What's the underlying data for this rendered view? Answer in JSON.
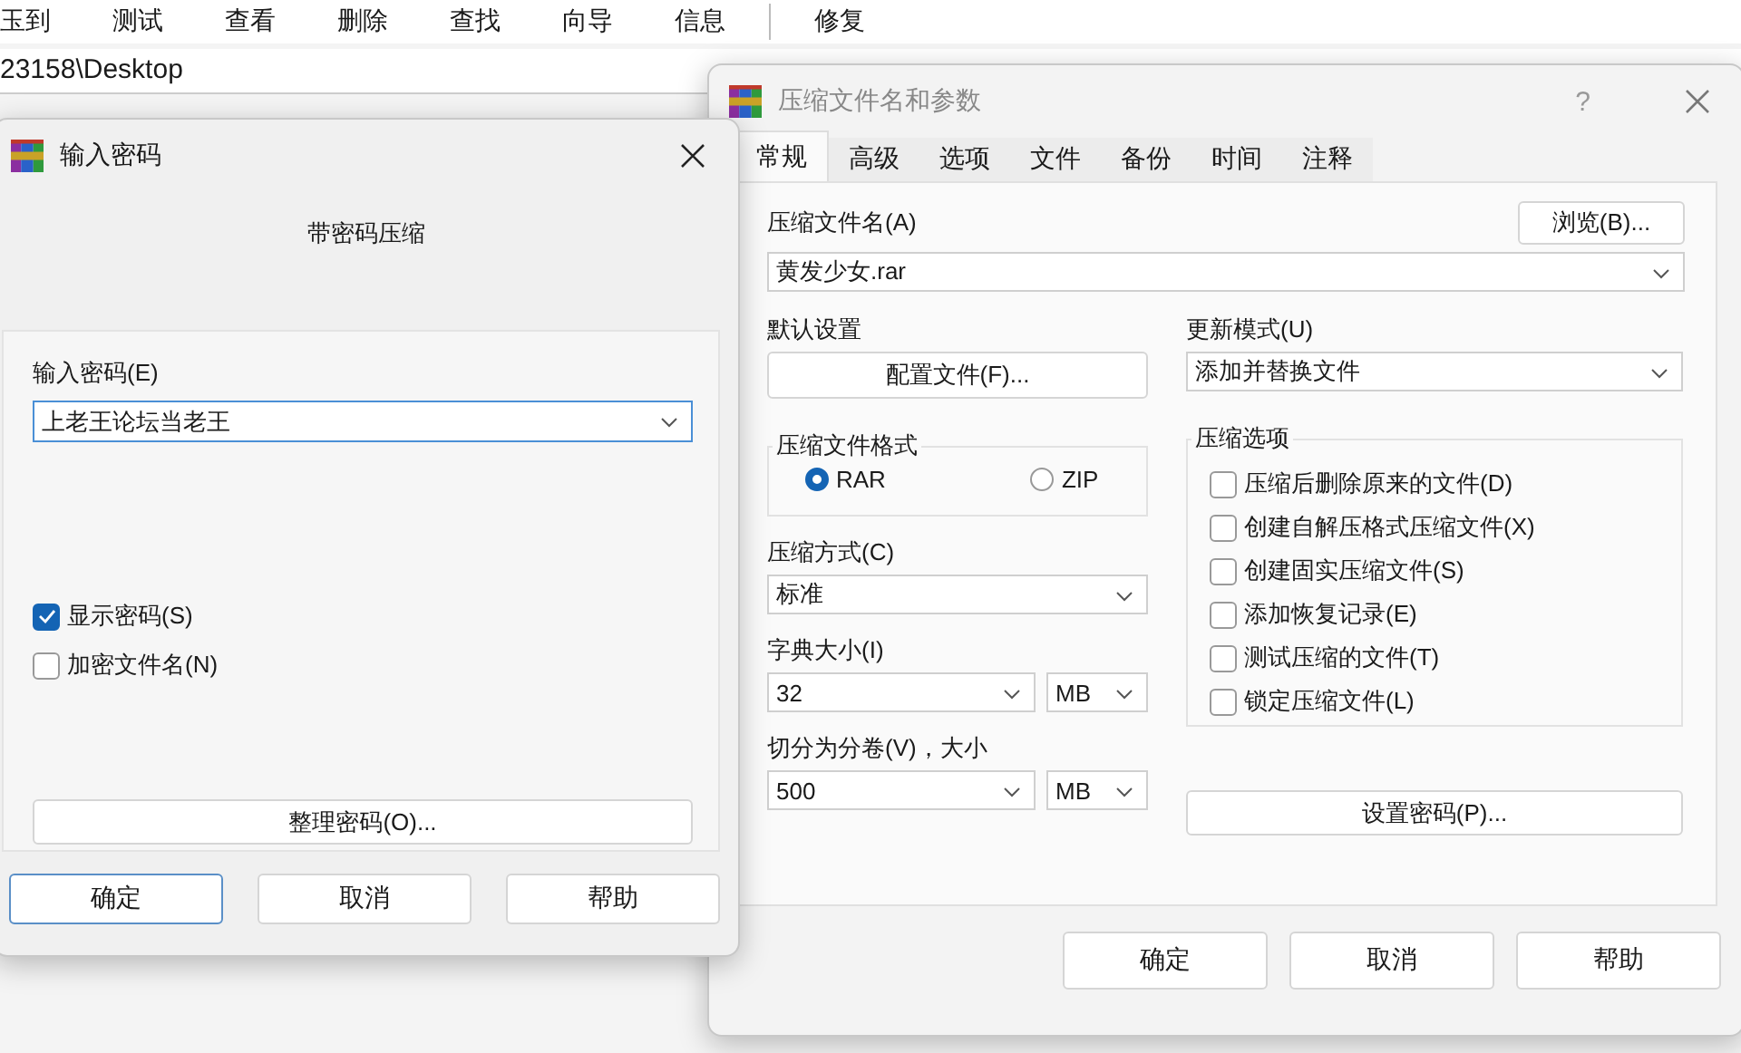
{
  "menu_bar": {
    "items": [
      "玉到",
      "测试",
      "查看",
      "删除",
      "查找",
      "向导",
      "信息",
      "修复"
    ]
  },
  "address_bar": {
    "path": "23158\\Desktop"
  },
  "archive_dialog": {
    "title": "压缩文件名和参数",
    "help_glyph": "?",
    "tabs": [
      {
        "label": "常规",
        "selected": true
      },
      {
        "label": "高级",
        "selected": false
      },
      {
        "label": "选项",
        "selected": false
      },
      {
        "label": "文件",
        "selected": false
      },
      {
        "label": "备份",
        "selected": false
      },
      {
        "label": "时间",
        "selected": false
      },
      {
        "label": "注释",
        "selected": false
      }
    ],
    "archive_name_label": "压缩文件名(A)",
    "browse_button": "浏览(B)...",
    "archive_name_value": "黄发少女.rar",
    "profiles_label": "默认设置",
    "profiles_button": "配置文件(F)...",
    "update_mode_label": "更新模式(U)",
    "update_mode_value": "添加并替换文件",
    "format_group": {
      "title": "压缩文件格式",
      "options": [
        {
          "label": "RAR",
          "selected": true
        },
        {
          "label": "ZIP",
          "selected": false
        }
      ]
    },
    "method_label": "压缩方式(C)",
    "method_value": "标准",
    "dictionary_label": "字典大小(I)",
    "dictionary_value": "32",
    "dictionary_unit": "MB",
    "split_label": "切分为分卷(V)，大小",
    "split_value": "500",
    "split_unit": "MB",
    "options_group": {
      "title": "压缩选项",
      "items": [
        {
          "label": "压缩后删除原来的文件(D)",
          "checked": false
        },
        {
          "label": "创建自解压格式压缩文件(X)",
          "checked": false
        },
        {
          "label": "创建固实压缩文件(S)",
          "checked": false
        },
        {
          "label": "添加恢复记录(E)",
          "checked": false
        },
        {
          "label": "测试压缩的文件(T)",
          "checked": false
        },
        {
          "label": "锁定压缩文件(L)",
          "checked": false
        }
      ]
    },
    "set_password_button": "设置密码(P)...",
    "buttons": [
      "确定",
      "取消",
      "帮助"
    ]
  },
  "password_dialog": {
    "title": "输入密码",
    "subtitle": "带密码压缩",
    "password_label": "输入密码(E)",
    "password_value": "上老王论坛当老王",
    "options": [
      {
        "label": "显示密码(S)",
        "checked": true
      },
      {
        "label": "加密文件名(N)",
        "checked": false
      }
    ],
    "organize_button": "整理密码(O)...",
    "buttons": [
      {
        "label": "确定",
        "default": true
      },
      {
        "label": "取消",
        "default": false
      },
      {
        "label": "帮助",
        "default": false
      }
    ]
  }
}
